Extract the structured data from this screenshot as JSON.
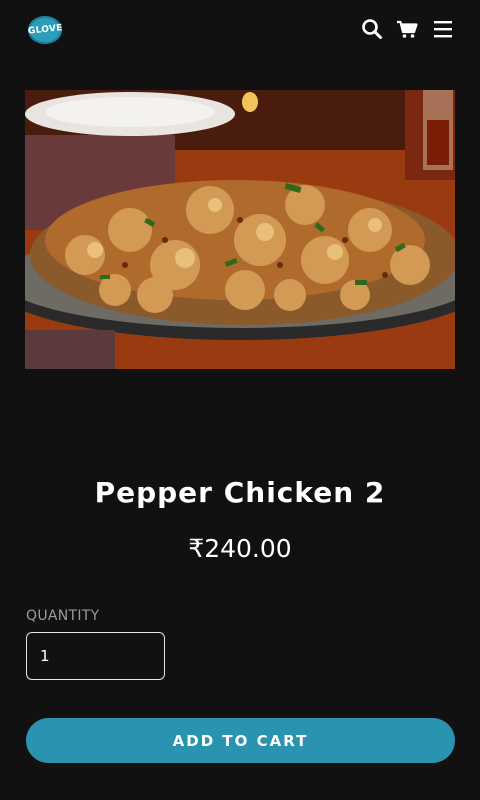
{
  "header": {
    "logo_text": "GLOVE",
    "icons": [
      "search-icon",
      "cart-icon",
      "menu-icon"
    ]
  },
  "product": {
    "image_alt": "plate-of-pepper-chicken",
    "title": "Pepper Chicken 2",
    "price": "₹240.00"
  },
  "quantity": {
    "label": "QUANTITY",
    "value": "1"
  },
  "actions": {
    "add_to_cart": "ADD TO CART"
  },
  "colors": {
    "background": "#111111",
    "accent": "#2a93b0",
    "text": "#ffffff",
    "muted": "#9a9a9a"
  }
}
